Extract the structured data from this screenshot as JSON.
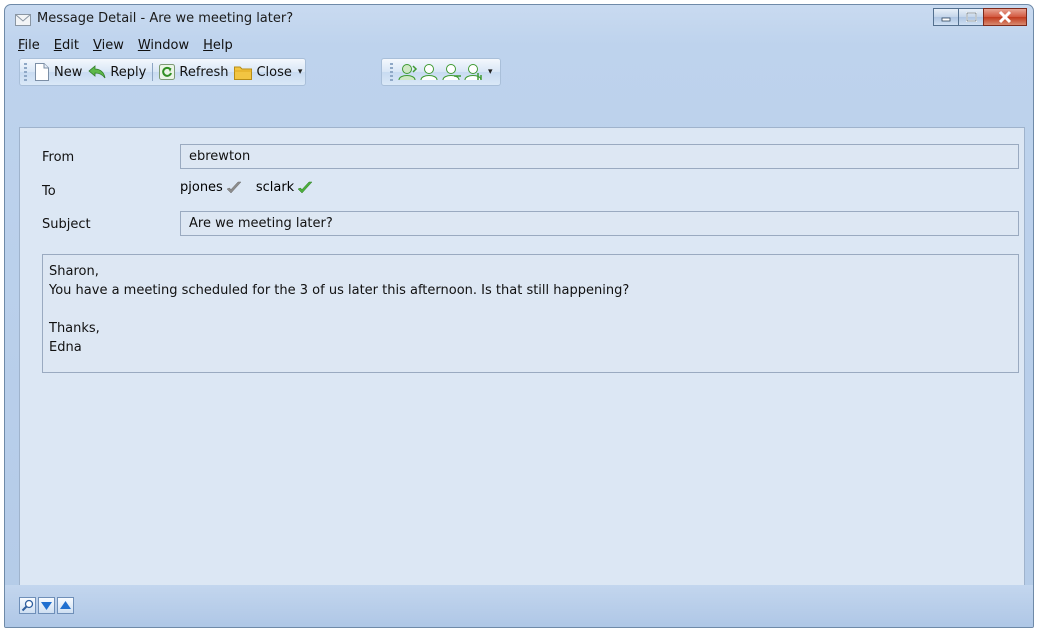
{
  "window": {
    "title": "Message Detail - Are we meeting later?",
    "title_icon": "envelope-icon"
  },
  "menu": {
    "items": [
      {
        "label": "File",
        "accel": "F",
        "rest": "ile"
      },
      {
        "label": "Edit",
        "accel": "E",
        "rest": "dit"
      },
      {
        "label": "View",
        "accel": "V",
        "rest": "iew"
      },
      {
        "label": "Window",
        "accel": "W",
        "rest": "indow"
      },
      {
        "label": "Help",
        "accel": "H",
        "rest": "elp"
      }
    ]
  },
  "toolbar": {
    "new_label": "New",
    "reply_label": "Reply",
    "refresh_label": "Refresh",
    "close_label": "Close"
  },
  "message": {
    "from_label": "From",
    "from_value": "ebrewton",
    "to_label": "To",
    "recipients": [
      {
        "name": "pjones",
        "status": "grey-check"
      },
      {
        "name": "sclark",
        "status": "green-check"
      }
    ],
    "subject_label": "Subject",
    "subject_value": "Are we meeting later?",
    "body_lines": [
      "Sharon,",
      "You have a meeting scheduled for the 3 of us later this afternoon. Is that still happening?",
      "",
      "Thanks,",
      "Edna"
    ]
  },
  "colors": {
    "accent_green": "#4caf3c",
    "check_grey": "#8c8c8c",
    "close_red": "#c13a1e"
  }
}
